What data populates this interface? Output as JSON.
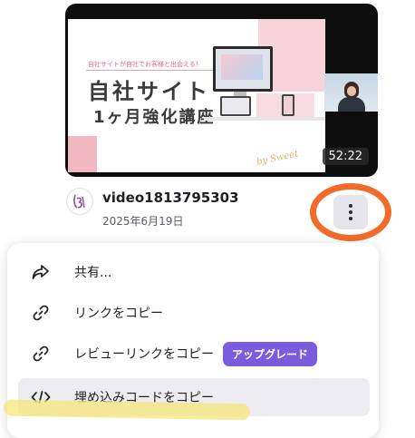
{
  "video": {
    "thumbnail": {
      "subtitle": "自社サイトが自社でお客様と出会える！",
      "title_line1": "自社サイト",
      "title_line2": "1ヶ月強化講座",
      "signature": "by Sweet"
    },
    "duration": "52:22",
    "title": "video1813795303",
    "date": "2025年6月19日"
  },
  "accent_colors": {
    "highlight_ring": "#f36b2a",
    "upgrade_badge": "#7b5cde",
    "marker": "#f7e678"
  },
  "menu": {
    "items": [
      {
        "icon": "share-icon",
        "label": "共有..."
      },
      {
        "icon": "link-icon",
        "label": "リンクをコピー"
      },
      {
        "icon": "link-icon",
        "label": "レビューリンクをコピー",
        "badge": "アップグレード"
      },
      {
        "icon": "code-icon",
        "label": "埋め込みコードをコピー"
      }
    ]
  }
}
